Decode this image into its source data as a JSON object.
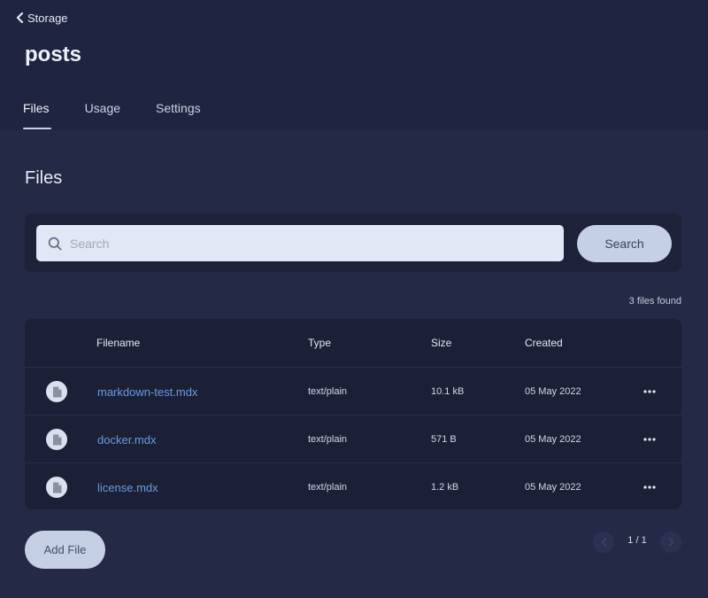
{
  "nav": {
    "back_label": "Storage"
  },
  "page": {
    "title": "posts"
  },
  "tabs": [
    {
      "label": "Files",
      "active": true
    },
    {
      "label": "Usage",
      "active": false
    },
    {
      "label": "Settings",
      "active": false
    }
  ],
  "section": {
    "title": "Files"
  },
  "search": {
    "placeholder": "Search",
    "value": "",
    "button_label": "Search"
  },
  "results": {
    "count_text": "3 files found"
  },
  "table": {
    "columns": [
      "Filename",
      "Type",
      "Size",
      "Created"
    ],
    "rows": [
      {
        "filename": "markdown-test.mdx",
        "type": "text/plain",
        "size": "10.1 kB",
        "created": "05 May 2022"
      },
      {
        "filename": "docker.mdx",
        "type": "text/plain",
        "size": "571 B",
        "created": "05 May 2022"
      },
      {
        "filename": "license.mdx",
        "type": "text/plain",
        "size": "1.2 kB",
        "created": "05 May 2022"
      }
    ]
  },
  "actions": {
    "add_file_label": "Add File"
  },
  "pagination": {
    "label": "1 / 1"
  },
  "icons": {
    "back": "chevron-left-icon",
    "search": "search-icon",
    "file": "file-icon",
    "more": "more-horizontal-icon",
    "prev": "chevron-left-icon",
    "next": "chevron-right-icon"
  },
  "colors": {
    "background": "#242a45",
    "header": "#1f2540",
    "panel": "#1b2036",
    "link": "#6b9be0",
    "button": "#c5d0e4"
  }
}
